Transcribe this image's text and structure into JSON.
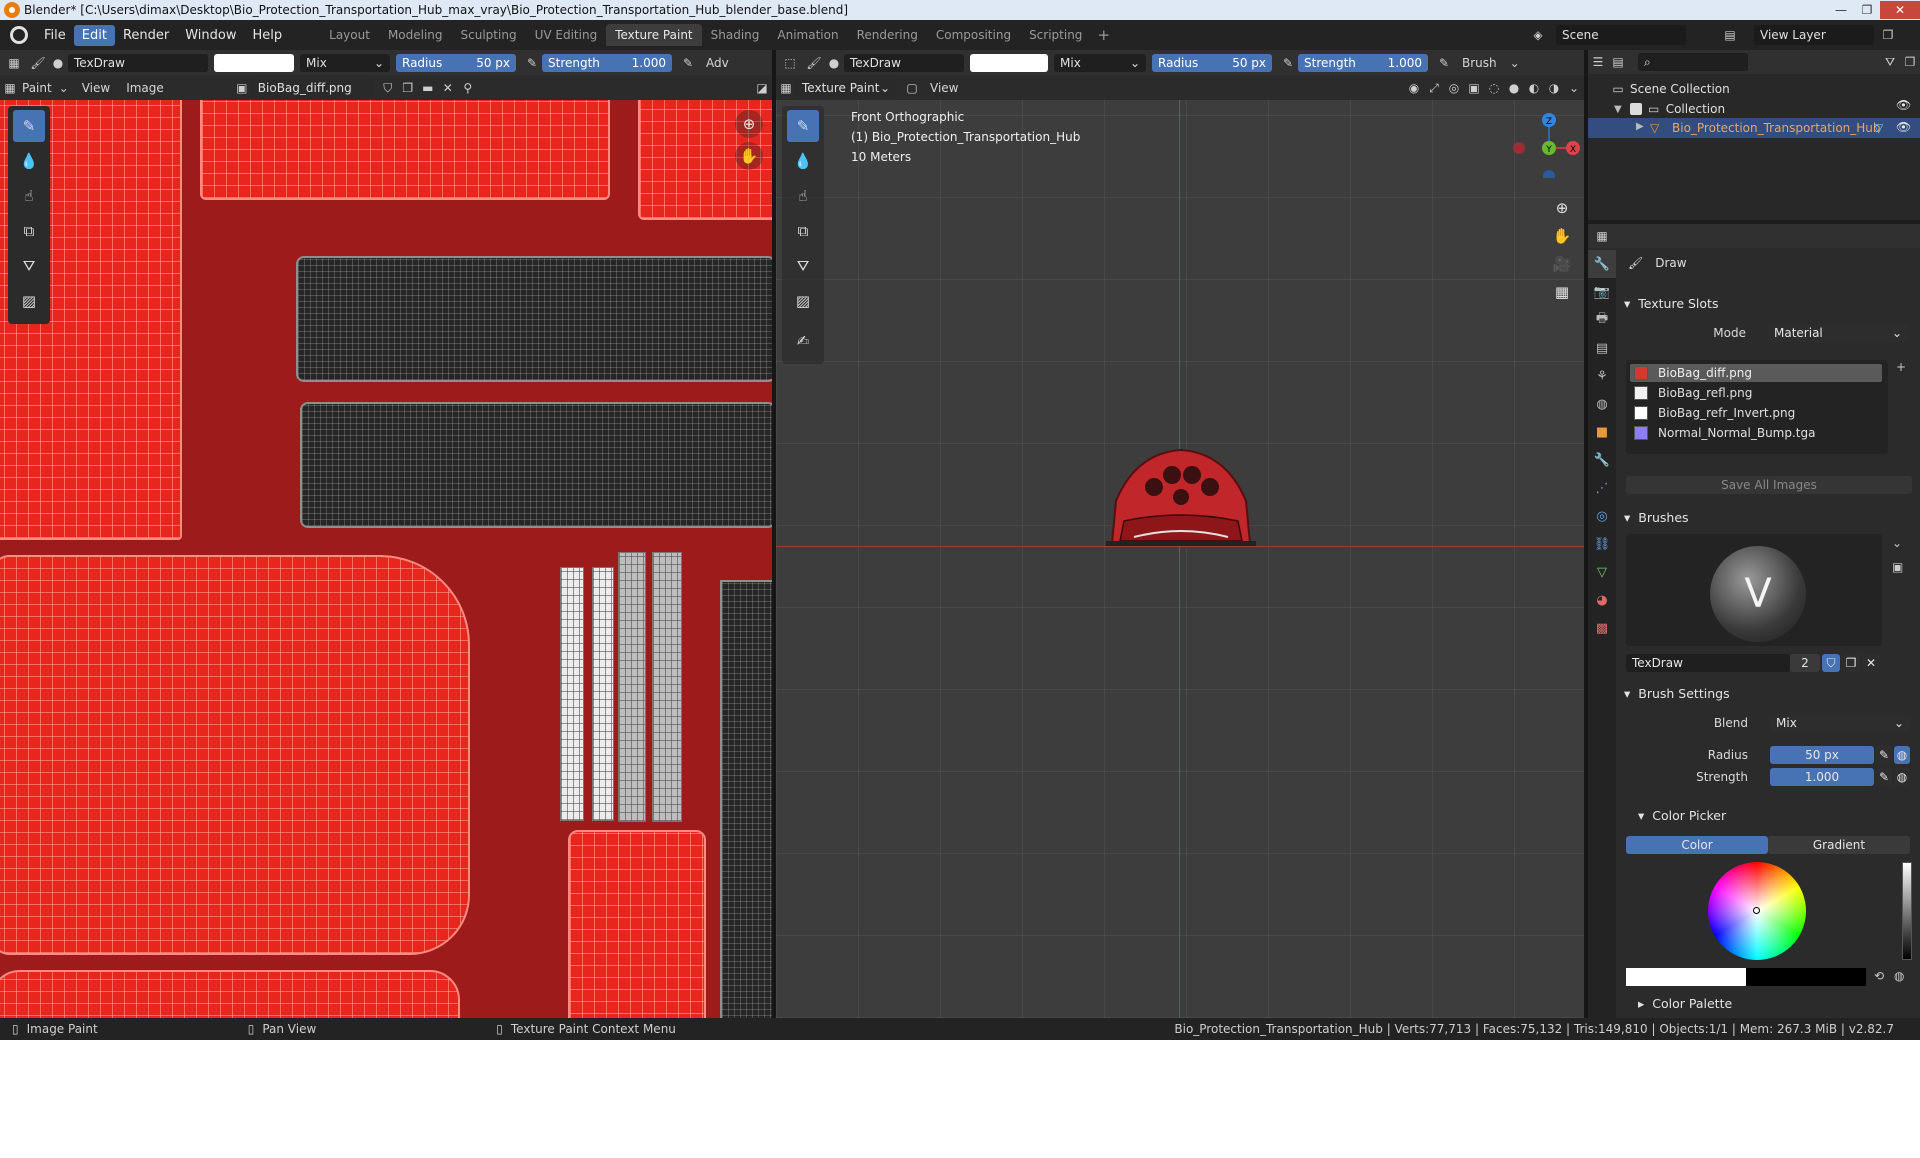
{
  "titlebar": {
    "title": "Blender* [C:\\Users\\dimax\\Desktop\\Bio_Protection_Transportation_Hub_max_vray\\Bio_Protection_Transportation_Hub_blender_base.blend]",
    "minimize": "—",
    "maximize": "❐",
    "close": "✕"
  },
  "menu": {
    "items": [
      "File",
      "Edit",
      "Render",
      "Window",
      "Help"
    ],
    "active": "Edit"
  },
  "workspaces": {
    "tabs": [
      "Layout",
      "Modeling",
      "Sculpting",
      "UV Editing",
      "Texture Paint",
      "Shading",
      "Animation",
      "Rendering",
      "Compositing",
      "Scripting"
    ],
    "active": "Texture Paint",
    "add": "+"
  },
  "scene": {
    "name": "Scene",
    "view_layer": "View Layer"
  },
  "uv_header": {
    "brush": "TexDraw",
    "blend": "Mix",
    "radius_label": "Radius",
    "radius_value": "50 px",
    "strength_label": "Strength",
    "strength_value": "1.000",
    "overflow": "Adv"
  },
  "uv_header2": {
    "mode": "Paint",
    "view": "View",
    "image": "Image",
    "image_name": "BioBag_diff.png"
  },
  "vp_header": {
    "brush": "TexDraw",
    "blend": "Mix",
    "radius_label": "Radius",
    "radius_value": "50 px",
    "strength_label": "Strength",
    "strength_value": "1.000",
    "brush_menu": "Brush"
  },
  "vp_header2": {
    "mode": "Texture Paint",
    "view": "View"
  },
  "viewport": {
    "view_name": "Front Orthographic",
    "object_line": "(1) Bio_Protection_Transportation_Hub",
    "scale": "10 Meters",
    "gizmo": {
      "z": "Z",
      "y": "Y",
      "x": "X"
    }
  },
  "outliner": {
    "scene_collection": "Scene Collection",
    "collection": "Collection",
    "object": "Bio_Protection_Transportation_Hub"
  },
  "properties": {
    "tool_name": "Draw",
    "texture_slots": {
      "title": "Texture Slots",
      "mode_label": "Mode",
      "mode_value": "Material",
      "slots": [
        {
          "name": "BioBag_diff.png",
          "color": "#d33a2c",
          "selected": true
        },
        {
          "name": "BioBag_refl.png",
          "color": "#f2f2f2",
          "selected": false
        },
        {
          "name": "BioBag_refr_Invert.png",
          "color": "#ffffff",
          "selected": false
        },
        {
          "name": "Normal_Normal_Bump.tga",
          "color": "#8c7cff",
          "selected": false
        }
      ],
      "save_all": "Save All Images"
    },
    "brushes": {
      "title": "Brushes",
      "brush_name": "TexDraw",
      "users": "2"
    },
    "brush_settings": {
      "title": "Brush Settings",
      "blend_label": "Blend",
      "blend_value": "Mix",
      "radius_label": "Radius",
      "radius_value": "50 px",
      "strength_label": "Strength",
      "strength_value": "1.000"
    },
    "color_picker": {
      "title": "Color Picker",
      "tab_color": "Color",
      "tab_gradient": "Gradient"
    },
    "color_palette": {
      "title": "Color Palette"
    }
  },
  "statusbar": {
    "left1": "Image Paint",
    "left2": "Pan View",
    "left3": "Texture Paint Context Menu",
    "stats": "Bio_Protection_Transportation_Hub | Verts:77,713 | Faces:75,132 | Tris:149,810 | Objects:1/1 | Mem: 267.3 MiB | v2.82.7"
  },
  "colors": {
    "accent": "#4772b3",
    "uv_background": "#9e1b1b",
    "uv_shell": "#e8261d",
    "viewport_bg": "#3d3d3d"
  }
}
